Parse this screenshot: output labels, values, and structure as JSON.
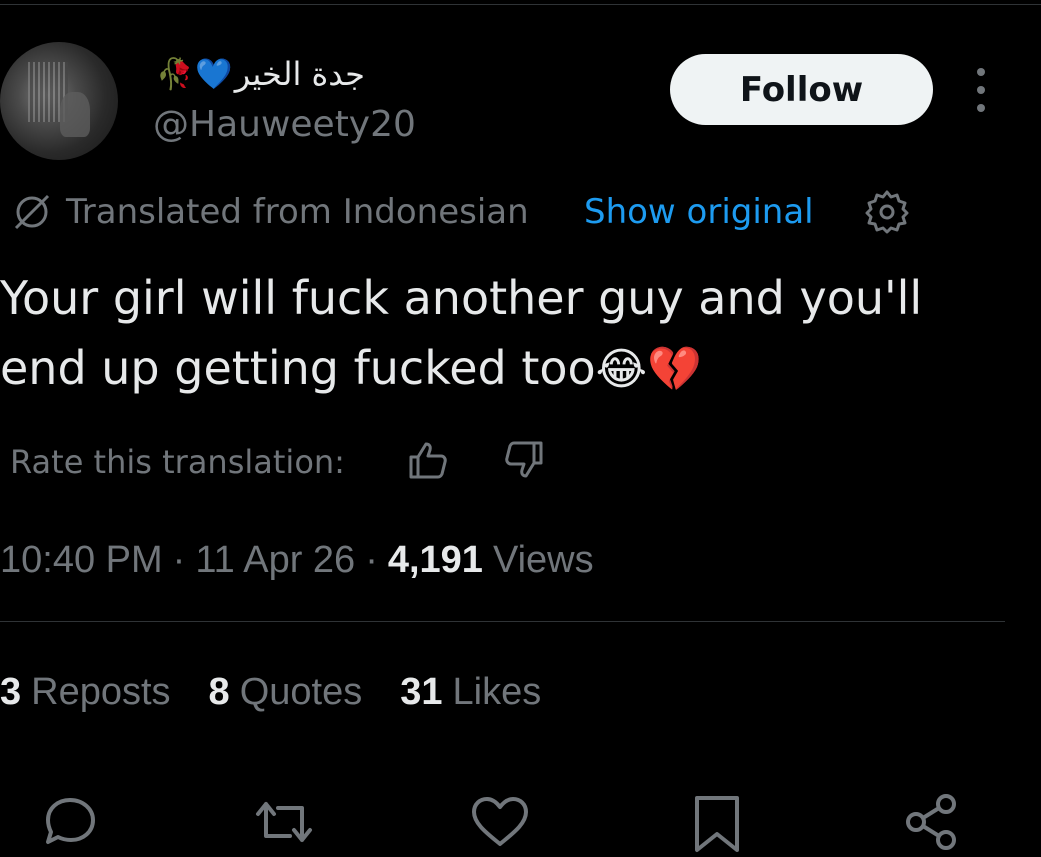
{
  "user": {
    "display_name": "جدة الخير",
    "name_emojis": [
      "🥀",
      "💙"
    ],
    "handle": "@Hauweety20"
  },
  "follow_label": "Follow",
  "translation": {
    "label": "Translated from Indonesian",
    "show_original": "Show original"
  },
  "tweet": {
    "line1": "Your girl will fuck another guy and you'll",
    "line2": "end up getting fucked too",
    "emojis": "😂💔"
  },
  "rate": {
    "label": "Rate this translation:"
  },
  "meta": {
    "time": "10:40 PM",
    "date": "11 Apr 26",
    "views_count": "4,191",
    "views_label": "Views"
  },
  "stats": {
    "reposts_count": "3",
    "reposts_label": "Reposts",
    "quotes_count": "8",
    "quotes_label": "Quotes",
    "likes_count": "31",
    "likes_label": "Likes"
  },
  "colors": {
    "background": "#000000",
    "text": "#e7e9ea",
    "muted": "#71767b",
    "link": "#1d9bf0",
    "divider": "#2f3336"
  }
}
